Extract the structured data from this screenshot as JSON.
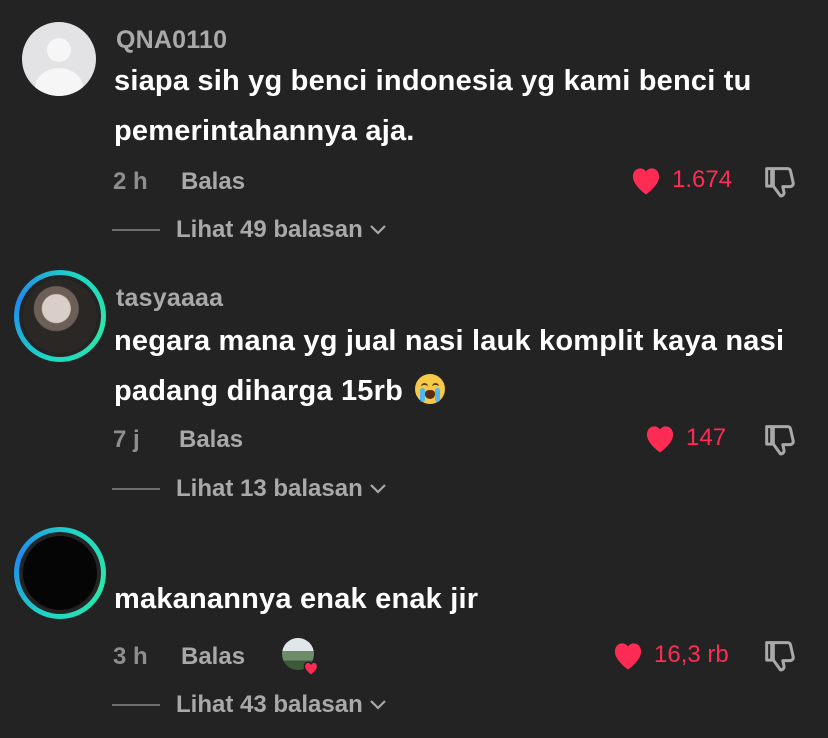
{
  "colors": {
    "background": "#232323",
    "like": "#fe2c55",
    "muted": "#a9a9a9"
  },
  "comments": [
    {
      "username": "QNA0110",
      "text": "siapa sih yg benci indonesia yg kami benci tu pemerintahannya aja.",
      "time": "2 h",
      "reply_label": "Balas",
      "likes": "1.674",
      "replies_label": "Lihat 49 balasan",
      "avatar": "default-avatar-icon"
    },
    {
      "username": "tasyaaaa",
      "text": "negara mana yg jual nasi lauk komplit kaya nasi padang diharga 15rb",
      "emoji": "crying-face-emoji",
      "time": "7 j",
      "reply_label": "Balas",
      "likes": "147",
      "replies_label": "Lihat 13 balasan",
      "avatar": "photo-avatar"
    },
    {
      "username": "",
      "text": "makanannya enak enak jir",
      "time": "3 h",
      "reply_label": "Balas",
      "likes": "16,3 rb",
      "replies_label": "Lihat 43 balasan",
      "avatar": "black-avatar",
      "creator_liked": true
    }
  ]
}
